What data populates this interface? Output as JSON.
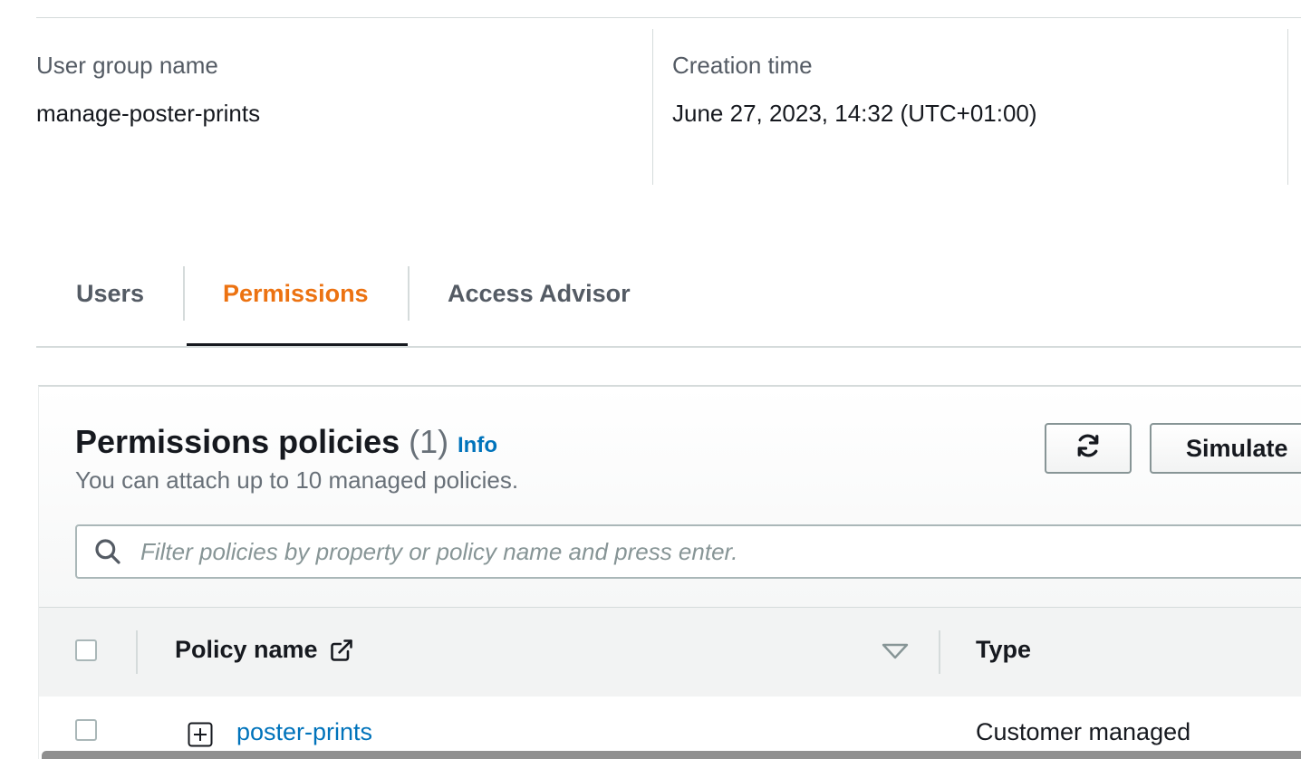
{
  "summary": {
    "group_name_label": "User group name",
    "group_name_value": "manage-poster-prints",
    "creation_time_label": "Creation time",
    "creation_time_value": "June 27, 2023, 14:32 (UTC+01:00)"
  },
  "tabs": [
    {
      "label": "Users",
      "active": false
    },
    {
      "label": "Permissions",
      "active": true
    },
    {
      "label": "Access Advisor",
      "active": false
    }
  ],
  "policies": {
    "title": "Permissions policies",
    "count": "(1)",
    "info_label": "Info",
    "description": "You can attach up to 10 managed policies.",
    "refresh_icon": "refresh-icon",
    "simulate_label": "Simulate",
    "filter_placeholder": "Filter policies by property or policy name and press enter.",
    "columns": {
      "policy_name": "Policy name",
      "type": "Type"
    },
    "rows": [
      {
        "name": "poster-prints",
        "type": "Customer managed"
      }
    ]
  },
  "colors": {
    "accent": "#ec7211",
    "link": "#0073bb",
    "text": "#16191f",
    "muted": "#545b64",
    "border": "#d5dbdb"
  }
}
